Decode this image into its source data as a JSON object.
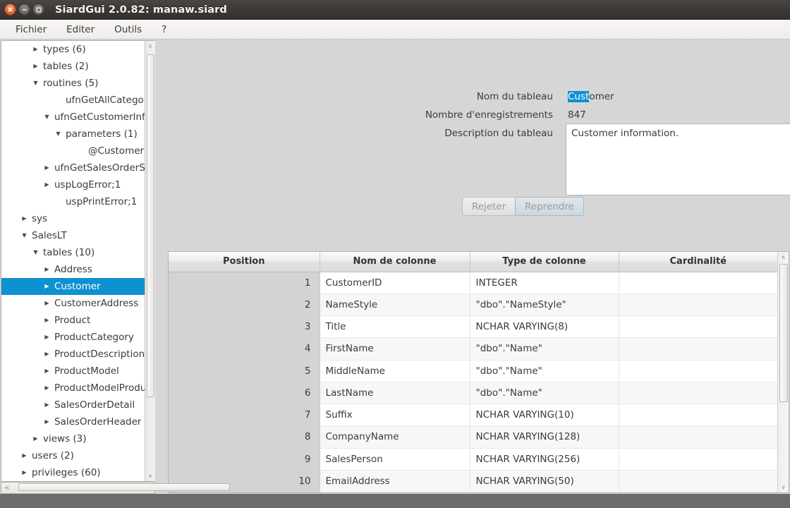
{
  "window": {
    "title": "SiardGui 2.0.82: manaw.siard",
    "controls": {
      "close": "×",
      "minimize": "−",
      "maximize": "□"
    }
  },
  "menubar": {
    "items": [
      {
        "label": "Fichier"
      },
      {
        "label": "Editer"
      },
      {
        "label": "Outils"
      },
      {
        "label": "?"
      }
    ]
  },
  "tree": {
    "nodes": [
      {
        "label": "types (6)",
        "indent": 2,
        "arrow": "collapsed",
        "selected": false
      },
      {
        "label": "tables (2)",
        "indent": 2,
        "arrow": "collapsed",
        "selected": false
      },
      {
        "label": "routines (5)",
        "indent": 2,
        "arrow": "expanded",
        "selected": false
      },
      {
        "label": "ufnGetAllCategories",
        "indent": 4,
        "arrow": "none",
        "selected": false
      },
      {
        "label": "ufnGetCustomerInfo",
        "indent": 3,
        "arrow": "expanded",
        "selected": false
      },
      {
        "label": "parameters (1)",
        "indent": 4,
        "arrow": "expanded",
        "selected": false
      },
      {
        "label": "@CustomerID",
        "indent": 6,
        "arrow": "none",
        "selected": false
      },
      {
        "label": "ufnGetSalesOrderSt",
        "indent": 3,
        "arrow": "collapsed",
        "selected": false
      },
      {
        "label": "uspLogError;1",
        "indent": 3,
        "arrow": "collapsed",
        "selected": false
      },
      {
        "label": "uspPrintError;1",
        "indent": 4,
        "arrow": "none",
        "selected": false
      },
      {
        "label": "sys",
        "indent": 1,
        "arrow": "collapsed",
        "selected": false
      },
      {
        "label": "SalesLT",
        "indent": 1,
        "arrow": "expanded",
        "selected": false
      },
      {
        "label": "tables (10)",
        "indent": 2,
        "arrow": "expanded",
        "selected": false
      },
      {
        "label": "Address",
        "indent": 3,
        "arrow": "collapsed",
        "selected": false
      },
      {
        "label": "Customer",
        "indent": 3,
        "arrow": "collapsed",
        "selected": true
      },
      {
        "label": "CustomerAddress",
        "indent": 3,
        "arrow": "collapsed",
        "selected": false
      },
      {
        "label": "Product",
        "indent": 3,
        "arrow": "collapsed",
        "selected": false
      },
      {
        "label": "ProductCategory",
        "indent": 3,
        "arrow": "collapsed",
        "selected": false
      },
      {
        "label": "ProductDescription",
        "indent": 3,
        "arrow": "collapsed",
        "selected": false
      },
      {
        "label": "ProductModel",
        "indent": 3,
        "arrow": "collapsed",
        "selected": false
      },
      {
        "label": "ProductModelProdu",
        "indent": 3,
        "arrow": "collapsed",
        "selected": false
      },
      {
        "label": "SalesOrderDetail",
        "indent": 3,
        "arrow": "collapsed",
        "selected": false
      },
      {
        "label": "SalesOrderHeader",
        "indent": 3,
        "arrow": "collapsed",
        "selected": false
      },
      {
        "label": "views (3)",
        "indent": 2,
        "arrow": "collapsed",
        "selected": false
      },
      {
        "label": "users (2)",
        "indent": 1,
        "arrow": "collapsed",
        "selected": false
      },
      {
        "label": "privileges (60)",
        "indent": 1,
        "arrow": "collapsed",
        "selected": false
      }
    ],
    "scroll_up_icon": "∧",
    "scroll_down_icon": "∨",
    "scroll_left_icon": "<",
    "scroll_right_icon": ">"
  },
  "form": {
    "table_name_label": "Nom du tableau",
    "table_name_selected": "Cust",
    "table_name_rest": "omer",
    "record_count_label": "Nombre d'enregistrements",
    "record_count_value": "847",
    "description_label": "Description du tableau",
    "description_value": "Customer information.",
    "reject_button": "Rejeter",
    "resume_button": "Reprendre"
  },
  "columns_table": {
    "headers": [
      "Position",
      "Nom de colonne",
      "Type de colonne",
      "Cardinalité"
    ],
    "rows": [
      {
        "position": "1",
        "name": "CustomerID",
        "type": "INTEGER",
        "cardinality": ""
      },
      {
        "position": "2",
        "name": "NameStyle",
        "type": "\"dbo\".\"NameStyle\"",
        "cardinality": ""
      },
      {
        "position": "3",
        "name": "Title",
        "type": "NCHAR VARYING(8)",
        "cardinality": ""
      },
      {
        "position": "4",
        "name": "FirstName",
        "type": "\"dbo\".\"Name\"",
        "cardinality": ""
      },
      {
        "position": "5",
        "name": "MiddleName",
        "type": "\"dbo\".\"Name\"",
        "cardinality": ""
      },
      {
        "position": "6",
        "name": "LastName",
        "type": "\"dbo\".\"Name\"",
        "cardinality": ""
      },
      {
        "position": "7",
        "name": "Suffix",
        "type": "NCHAR VARYING(10)",
        "cardinality": ""
      },
      {
        "position": "8",
        "name": "CompanyName",
        "type": "NCHAR VARYING(128)",
        "cardinality": ""
      },
      {
        "position": "9",
        "name": "SalesPerson",
        "type": "NCHAR VARYING(256)",
        "cardinality": ""
      },
      {
        "position": "10",
        "name": "EmailAddress",
        "type": "NCHAR VARYING(50)",
        "cardinality": ""
      }
    ]
  },
  "colors": {
    "selection": "#0d91d1",
    "window_bg": "#d6d6d6",
    "desktop": "#6b6b6b"
  }
}
